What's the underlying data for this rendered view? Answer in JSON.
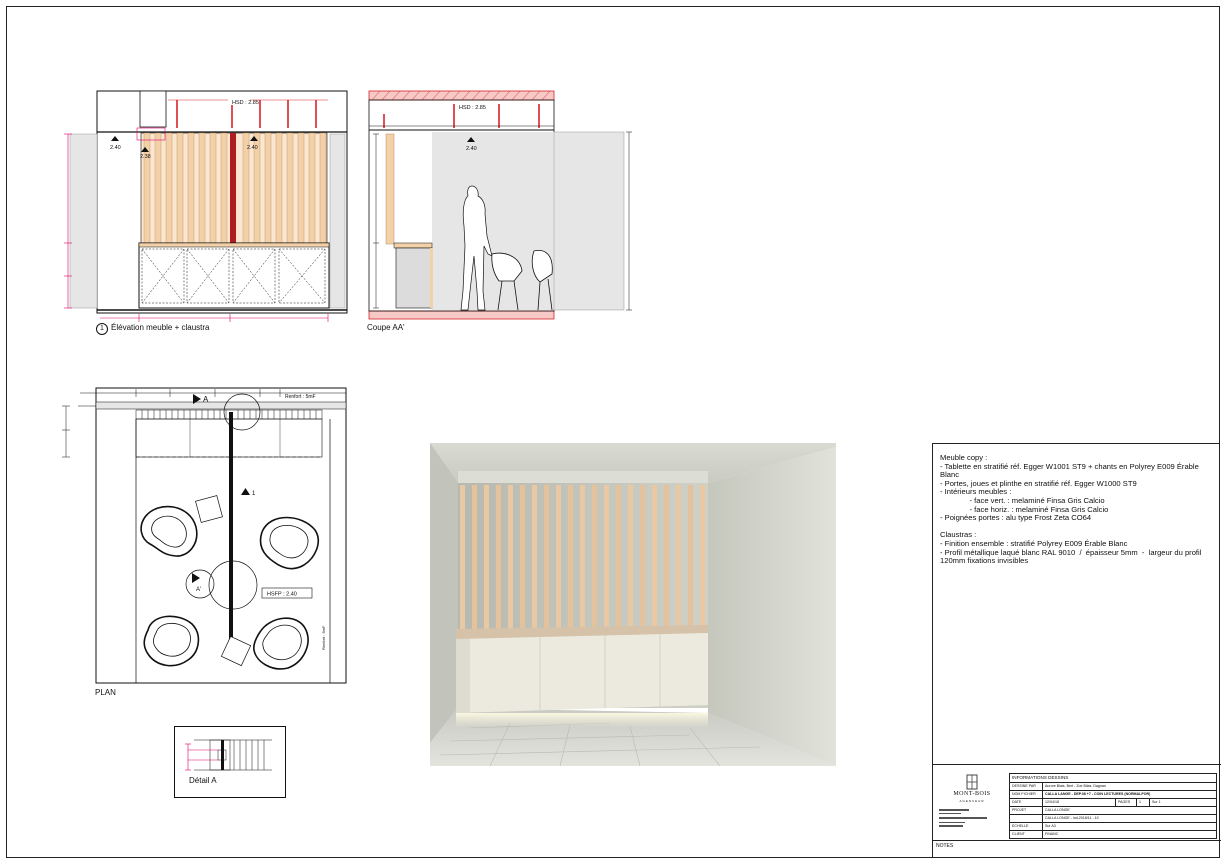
{
  "views": {
    "elevation": {
      "number": "1",
      "title": "Élévation meuble + claustra",
      "hsd": "HSD : 2.85",
      "levels": [
        "2.40",
        "2.38",
        "2.40"
      ]
    },
    "section": {
      "title": "Coupe AA'",
      "hsd": "HSD : 2.85",
      "level": "2.40"
    },
    "plan": {
      "title": "PLAN",
      "hsfp": "HSFP : 2.40",
      "marker_a": "A",
      "marker_a_prime": "A'",
      "marker_1": "1",
      "soffit_label": "Renfort : 5mF"
    },
    "detail": {
      "title": "Détail A"
    }
  },
  "notes": {
    "lines": [
      "Meuble copy :",
      "- Tablette en stratifié réf. Egger W1001 ST9 + chants en Polyrey E009 Érable Blanc",
      "- Portes, joues et plinthe en stratifié réf. Egger W1000 ST9",
      "- Intérieurs meubles :",
      "              - face vert. : melaminé Finsa Gris Calcio",
      "              - face horiz. : melaminé Finsa Gris Calcio",
      "- Poignées portes : alu type Frost Zeta CO64",
      "",
      "Claustras :",
      "- Finition ensemble : stratifié Polyrey E009 Érable Blanc",
      "- Profil métallique laqué blanc RAL 9010  /  épaisseur 5mm  -  largeur du profil 120mm fixations invisibles"
    ]
  },
  "title_block": {
    "company": "MONT-BOIS",
    "company_sub": "AGENCEUR",
    "header": "INFORMATIONS DESSINS",
    "rows": [
      {
        "key": "DESSINE PAR",
        "value": "Aurore Blais, Bert - Zoe Bilas, Dagnan"
      },
      {
        "key": "NOM FICHIER",
        "value": "CALLA LANGE - DEP.08 +7 - COIN LECTURES (NORMALPOR)"
      },
      {
        "key": "DATE",
        "value": "12/04/18"
      },
      {
        "key": "PROJET",
        "value": "CALLA LONGE"
      },
      {
        "key": "",
        "value": "CALLA LONGE - ind.2018/11 - 10"
      },
      {
        "key": "ECHELLE",
        "value": "Sur A3"
      },
      {
        "key": "CLIENT",
        "value": "FINANC"
      }
    ],
    "page_label": "PAGES",
    "page_value": "1",
    "page_of": "Sur 1",
    "footer": "NOTES"
  },
  "colors": {
    "dimension": "#e0006a",
    "structure": "#d8232a",
    "hatch": "#c0392b",
    "wood": "#f3d1a8",
    "line": "#111111",
    "panel_gray": "#e6e6e6"
  }
}
